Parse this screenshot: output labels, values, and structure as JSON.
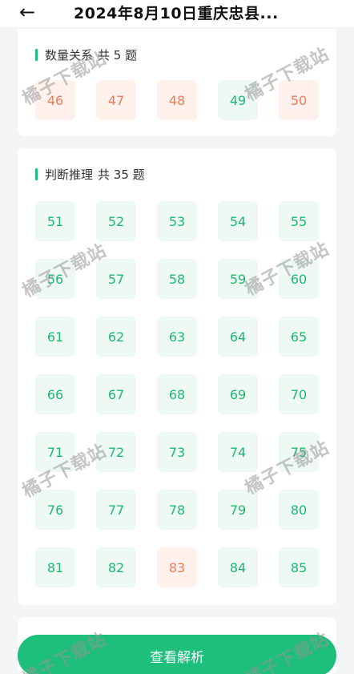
{
  "header": {
    "back_icon": "arrow-left-icon",
    "title": "2024年8月10日重庆忠县..."
  },
  "sections": [
    {
      "name": "数量关系",
      "count_text": "共 5 题",
      "questions": [
        {
          "num": "46",
          "status": "wrong"
        },
        {
          "num": "47",
          "status": "wrong"
        },
        {
          "num": "48",
          "status": "wrong"
        },
        {
          "num": "49",
          "status": "correct"
        },
        {
          "num": "50",
          "status": "wrong"
        }
      ]
    },
    {
      "name": "判断推理",
      "count_text": "共 35 题",
      "questions": [
        {
          "num": "51",
          "status": "correct"
        },
        {
          "num": "52",
          "status": "correct"
        },
        {
          "num": "53",
          "status": "correct"
        },
        {
          "num": "54",
          "status": "correct"
        },
        {
          "num": "55",
          "status": "correct"
        },
        {
          "num": "56",
          "status": "correct"
        },
        {
          "num": "57",
          "status": "correct"
        },
        {
          "num": "58",
          "status": "correct"
        },
        {
          "num": "59",
          "status": "correct"
        },
        {
          "num": "60",
          "status": "correct"
        },
        {
          "num": "61",
          "status": "correct"
        },
        {
          "num": "62",
          "status": "correct"
        },
        {
          "num": "63",
          "status": "correct"
        },
        {
          "num": "64",
          "status": "correct"
        },
        {
          "num": "65",
          "status": "correct"
        },
        {
          "num": "66",
          "status": "correct"
        },
        {
          "num": "67",
          "status": "correct"
        },
        {
          "num": "68",
          "status": "correct"
        },
        {
          "num": "69",
          "status": "correct"
        },
        {
          "num": "70",
          "status": "correct"
        },
        {
          "num": "71",
          "status": "correct"
        },
        {
          "num": "72",
          "status": "correct"
        },
        {
          "num": "73",
          "status": "correct"
        },
        {
          "num": "74",
          "status": "correct"
        },
        {
          "num": "75",
          "status": "correct"
        },
        {
          "num": "76",
          "status": "correct"
        },
        {
          "num": "77",
          "status": "correct"
        },
        {
          "num": "78",
          "status": "correct"
        },
        {
          "num": "79",
          "status": "correct"
        },
        {
          "num": "80",
          "status": "correct"
        },
        {
          "num": "81",
          "status": "correct"
        },
        {
          "num": "82",
          "status": "correct"
        },
        {
          "num": "83",
          "status": "wrong"
        },
        {
          "num": "84",
          "status": "correct"
        },
        {
          "num": "85",
          "status": "correct"
        }
      ]
    }
  ],
  "watermark_text": "橘子下载站",
  "action_button": "查看解析",
  "colors": {
    "accent": "#1dbf7b",
    "correct_text": "#1fb873",
    "correct_bg": "#eef9f3",
    "wrong_text": "#f07a5a",
    "wrong_bg": "#fff1ec"
  }
}
